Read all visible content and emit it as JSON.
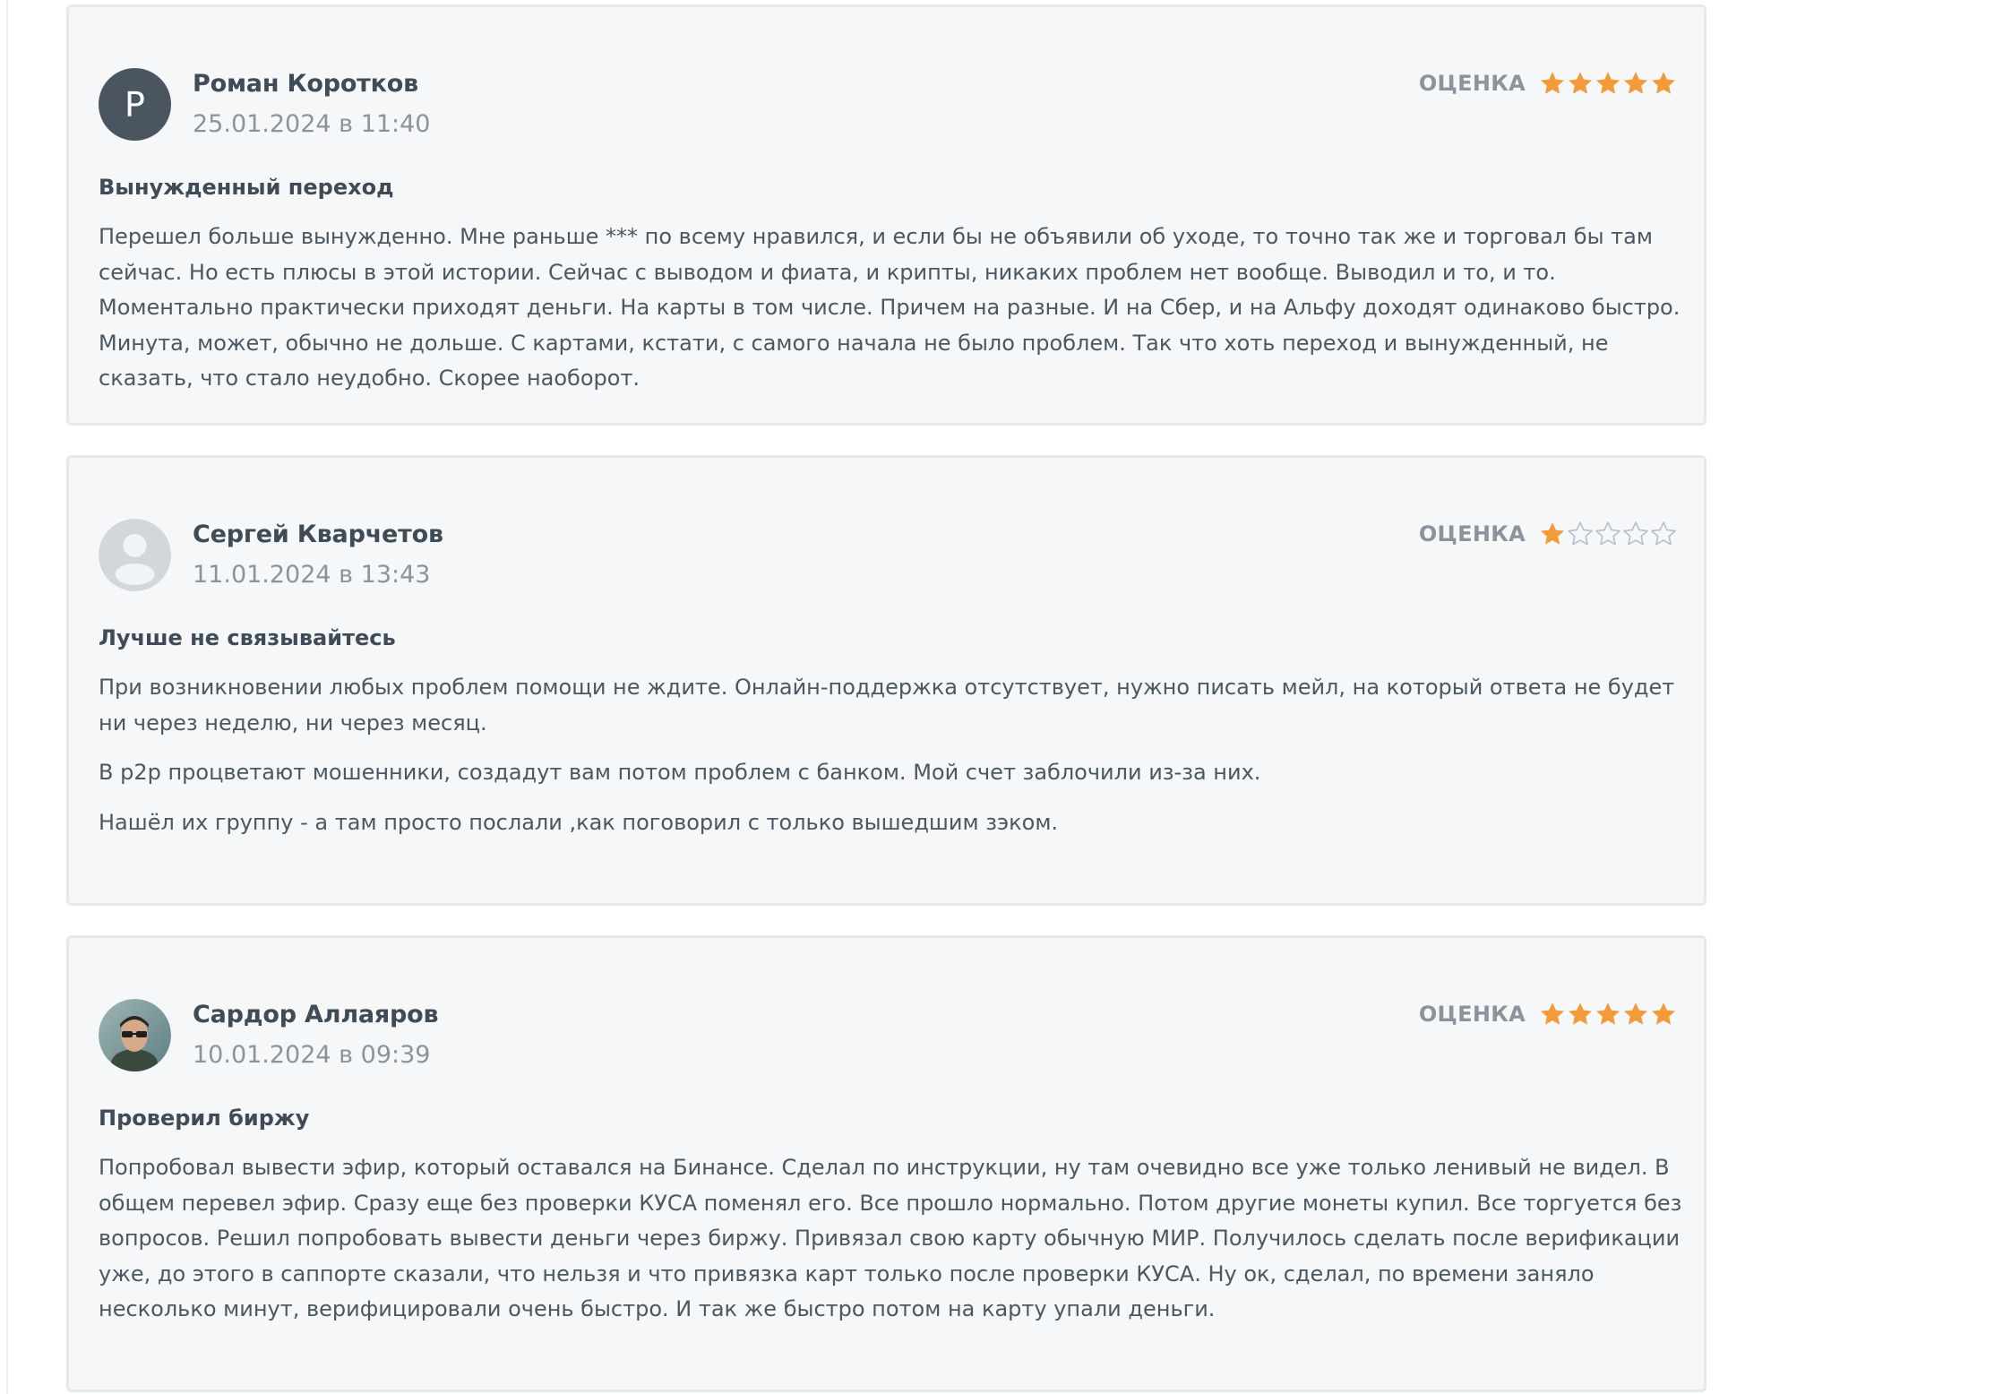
{
  "reviews": [
    {
      "avatar_letter": "Р",
      "avatar_type": "letter",
      "author": "Роман Коротков",
      "date": "25.01.2024 в 11:40",
      "rating_label": "ОЦЕНКА",
      "rating": 5,
      "title": "Вынужденный переход",
      "paragraphs": [
        "Перешел больше вынужденно. Мне раньше *** по всему нравился, и если бы не объявили об уходе, то точно так же и торговал бы там сейчас. Но есть плюсы в этой истории. Сейчас с выводом и фиата, и крипты, никаких проблем нет вообще. Выводил и то, и то. Моментально практически приходят деньги. На карты в том числе. Причем на разные. И на Сбер, и на Альфу доходят одинаково быстро. Минута, может, обычно не дольше. С картами, кстати, с самого начала не было проблем. Так что хоть переход и вынужденный, не сказать, что стало неудобно. Скорее наоборот."
      ]
    },
    {
      "avatar_type": "placeholder",
      "author": "Сергей Кварчетов",
      "date": "11.01.2024 в 13:43",
      "rating_label": "ОЦЕНКА",
      "rating": 1,
      "title": "Лучше не связывайтесь",
      "paragraphs": [
        "При возникновении любых проблем помощи не ждите. Онлайн-поддержка отсутствует, нужно писать мейл, на который ответа не будет ни через неделю, ни через месяц.",
        "В p2p процветают мошенники, создадут вам потом проблем с банком. Мой счет заблочили из-за них.",
        "Нашёл их группу - а там просто послали ,как поговорил с только вышедшим зэком."
      ]
    },
    {
      "avatar_type": "photo",
      "author": "Сардор Аллаяров",
      "date": "10.01.2024 в 09:39",
      "rating_label": "ОЦЕНКА",
      "rating": 5,
      "title": "Проверил биржу",
      "paragraphs": [
        "Попробовал вывести эфир, который оставался на Бинансе. Сделал по инструкции, ну там очевидно все уже только ленивый не видел. В общем перевел эфир. Сразу еще без проверки КУСА поменял его. Все прошло нормально. Потом другие монеты купил. Все торгуется без вопросов. Решил попробовать вывести деньги через биржу. Привязал свою карту обычную МИР. Получилось сделать после верификации уже, до этого в саппорте сказали, что нельзя и что привязка карт только после проверки КУСА. Ну ок, сделал, по времени заняло несколько минут, верифицировали очень быстро. И так же быстро потом на карту упали деньги."
      ]
    }
  ],
  "colors": {
    "star_filled": "#f29b38",
    "star_empty": "#b8bec4",
    "card_bg": "#f6f7f9",
    "card_border": "#e6e9ec"
  }
}
